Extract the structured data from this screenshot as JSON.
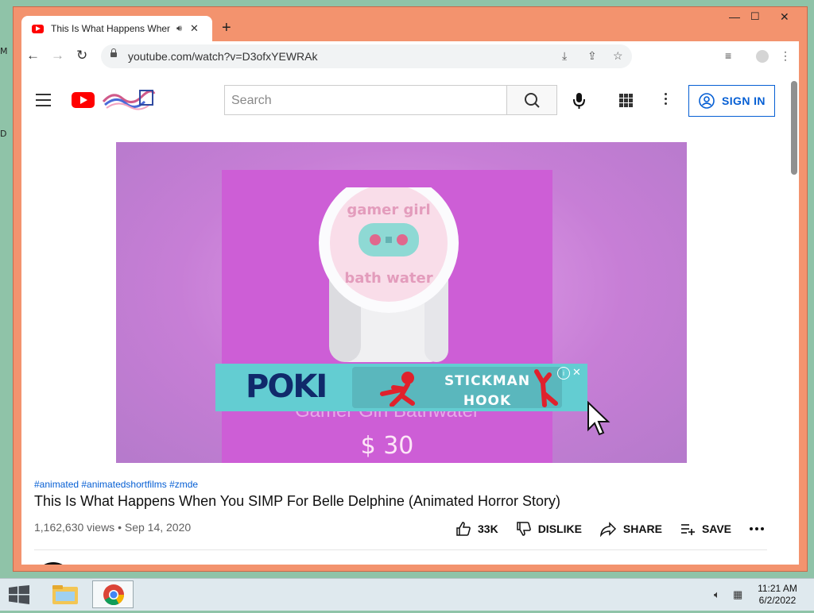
{
  "browser": {
    "tab_title": "This Is What Happens When You SIMP For Belle Delphine (Animated Horror Story) - YouTube",
    "url": "youtube.com/watch?v=D3ofxYEWRAk",
    "window_controls": [
      "minimize-icon",
      "maximize-icon",
      "close-icon"
    ]
  },
  "youtube": {
    "search_placeholder": "Search",
    "sign_in_label": "SIGN IN",
    "brand_color": "#ff0000",
    "accent_color": "#065fd4"
  },
  "video": {
    "ad": {
      "brand": "POKI",
      "title_line1": "STICKMAN",
      "title_line2": "HOOK",
      "info": "i",
      "close": "✕"
    },
    "jar_text": "gamer girl bath water",
    "price": "$ 30"
  },
  "details": {
    "hashtags": "#animated #animatedshortfilms #zmde",
    "title": "This Is What Happens When You SIMP For Belle Delphine (Animated Horror Story)",
    "meta": "1,162,630 views • Sep 14, 2020",
    "actions": {
      "like": "33K",
      "dislike": "DISLIKE",
      "share": "SHARE",
      "save": "SAVE"
    }
  },
  "taskbar": {
    "time": "11:21 AM",
    "date": "6/2/2022"
  }
}
